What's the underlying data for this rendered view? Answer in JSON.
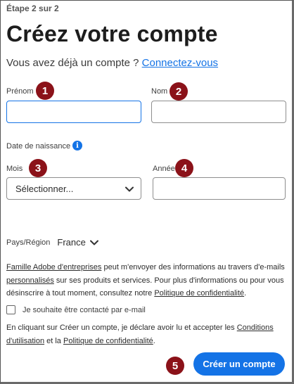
{
  "step": "Étape 2 sur 2",
  "title": "Créez votre compte",
  "signin": {
    "prompt": "Vous avez déjà un compte ?",
    "link": "Connectez-vous"
  },
  "fields": {
    "first_name_label": "Prénom",
    "last_name_label": "Nom",
    "birthdate_label": "Date de naissance",
    "month_label": "Mois",
    "month_value": "Sélectionner...",
    "year_label": "Année"
  },
  "country": {
    "label": "Pays/Région",
    "value": "France"
  },
  "consent": {
    "p1": "Famille Adobe d'entreprises",
    "p2": " peut m'envoyer des informations au travers d'e-mails ",
    "p3": "personnalisés",
    "p4": " sur ses produits et services. Pour plus d'informations ou pour vous désinscrire à tout moment, consultez notre ",
    "p5": "Politique de confidentialité",
    "p6": "."
  },
  "checkbox_label": "Je souhaite être contacté par e-mail",
  "terms": {
    "p1": "En cliquant sur Créer un compte, je déclare avoir lu et accepter les ",
    "p2": "Conditions d'utilisation",
    "p3": " et la ",
    "p4": "Politique de confidentialité",
    "p5": "."
  },
  "submit_label": "Créer un compte",
  "badges": [
    "1",
    "2",
    "3",
    "4",
    "5"
  ],
  "colors": {
    "accent": "#1473e6",
    "badge": "#8b1219"
  },
  "icons": {
    "info": "info-icon",
    "chevron": "chevron-down-icon"
  }
}
